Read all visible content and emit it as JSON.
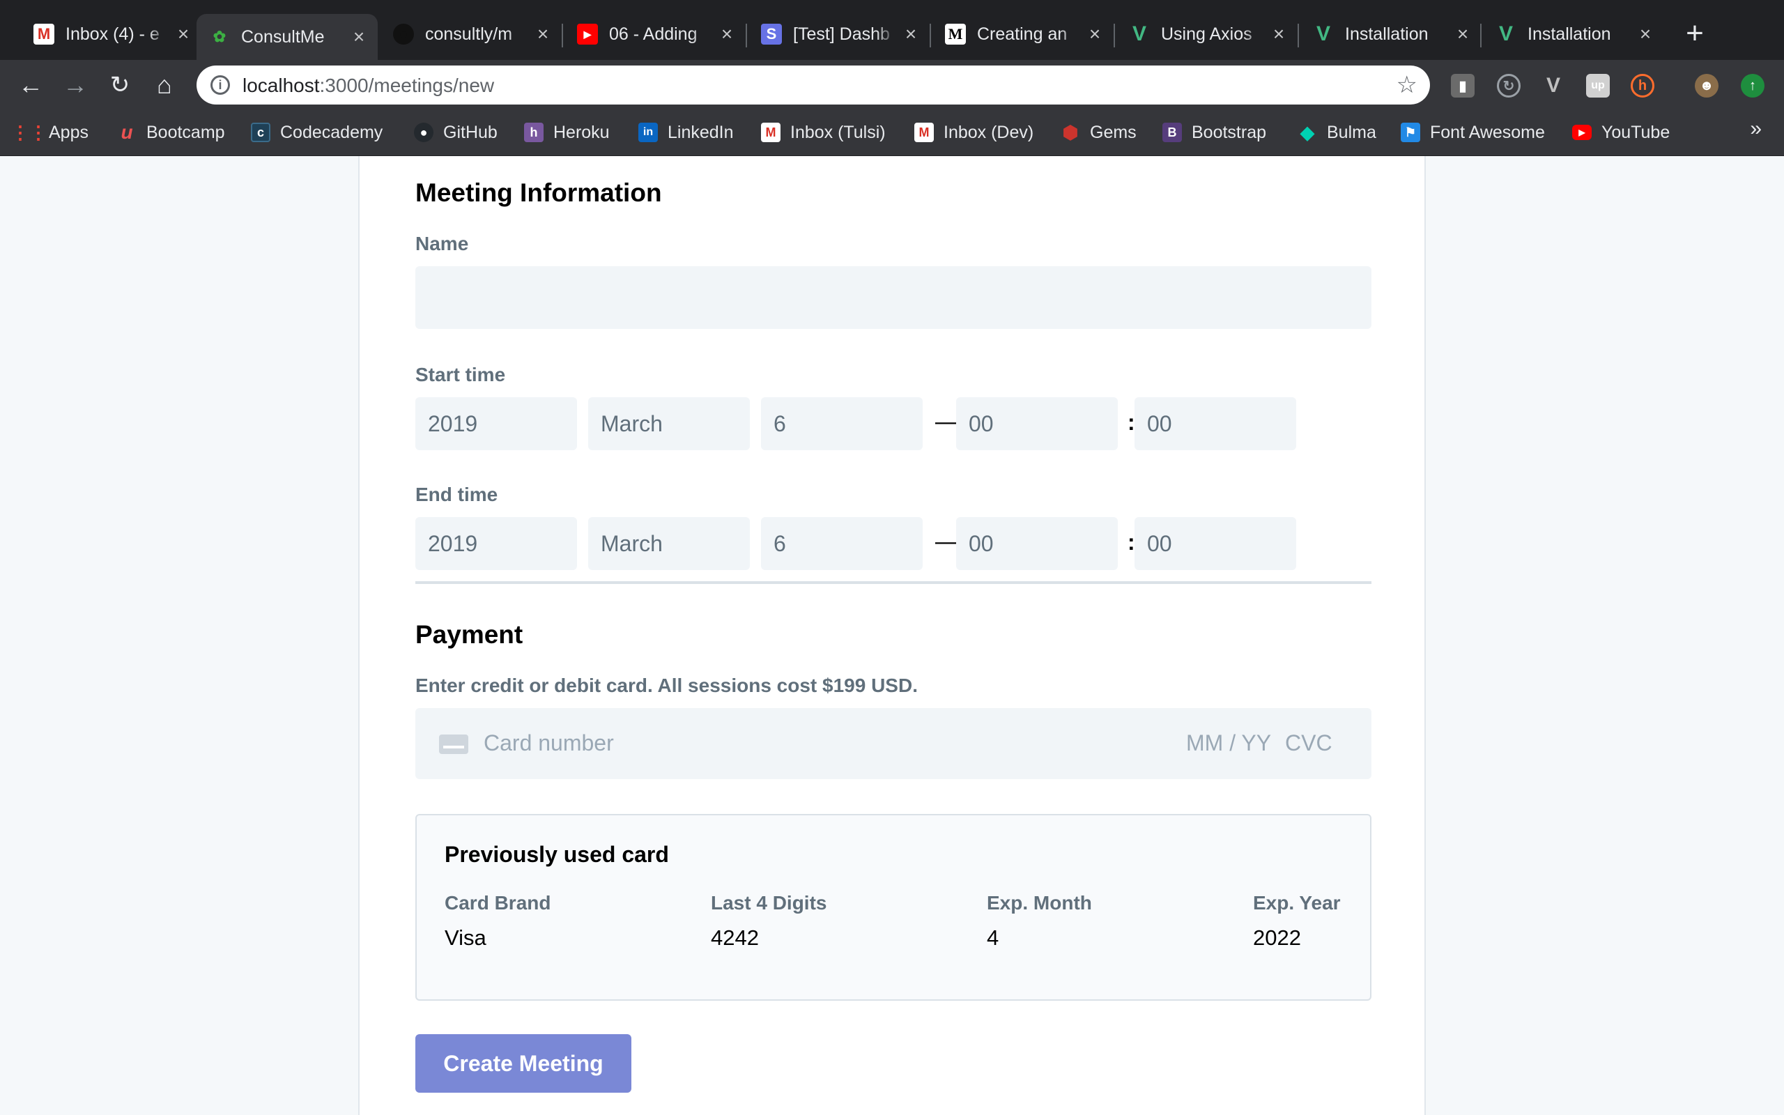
{
  "browser": {
    "tabs": [
      {
        "title": "Inbox (4) - e",
        "icon": "gmail-icon",
        "color": "#d93025",
        "glyph": "M"
      },
      {
        "title": "ConsultMe",
        "icon": "leaf-icon",
        "color": "#3cb043",
        "glyph": "✿"
      },
      {
        "title": "consultly/m",
        "icon": "github-icon",
        "color": "#111111",
        "glyph": "●"
      },
      {
        "title": "06 - Adding",
        "icon": "youtube-icon",
        "color": "#ff0000",
        "glyph": "▶"
      },
      {
        "title": "[Test] Dashb",
        "icon": "stripe-icon",
        "color": "#6772e5",
        "glyph": "S"
      },
      {
        "title": "Creating an",
        "icon": "medium-icon",
        "color": "#000000",
        "glyph": "M"
      },
      {
        "title": "Using Axios",
        "icon": "vue-icon",
        "color": "#42b883",
        "glyph": "V"
      },
      {
        "title": "Installation",
        "icon": "vue-icon",
        "color": "#42b883",
        "glyph": "V"
      },
      {
        "title": "Installation",
        "icon": "vue-icon",
        "color": "#42b883",
        "glyph": "V"
      }
    ],
    "active_tab": 1,
    "url_host": "localhost",
    "url_path": ":3000/meetings/new",
    "bookmarks": [
      {
        "label": "Apps",
        "icon": "apps-grid-icon",
        "color": "#ea4335",
        "glyph": "⋮"
      },
      {
        "label": "Bootcamp",
        "icon": "udemy-icon",
        "color": "#ec5252",
        "glyph": "u"
      },
      {
        "label": "Codecademy",
        "icon": "codecademy-icon",
        "color": "#1f4056",
        "glyph": "c"
      },
      {
        "label": "GitHub",
        "icon": "github-icon",
        "color": "#24292e",
        "glyph": "●"
      },
      {
        "label": "Heroku",
        "icon": "heroku-icon",
        "color": "#79589f",
        "glyph": "h"
      },
      {
        "label": "LinkedIn",
        "icon": "linkedin-icon",
        "color": "#0a66c2",
        "glyph": "in"
      },
      {
        "label": "Inbox (Tulsi)",
        "icon": "gmail-icon",
        "color": "#d93025",
        "glyph": "M"
      },
      {
        "label": "Inbox (Dev)",
        "icon": "gmail-icon",
        "color": "#d93025",
        "glyph": "M"
      },
      {
        "label": "Gems",
        "icon": "ruby-icon",
        "color": "#cc342d",
        "glyph": "◆"
      },
      {
        "label": "Bootstrap",
        "icon": "bootstrap-icon",
        "color": "#563d7c",
        "glyph": "B"
      },
      {
        "label": "Bulma",
        "icon": "bulma-icon",
        "color": "#00d1b2",
        "glyph": "◆"
      },
      {
        "label": "Font Awesome",
        "icon": "flag-icon",
        "color": "#228ae6",
        "glyph": "⚑"
      },
      {
        "label": "YouTube",
        "icon": "youtube-icon",
        "color": "#ff0000",
        "glyph": "▶"
      }
    ],
    "more_bookmarks": "»"
  },
  "form": {
    "meeting_title": "Meeting Information",
    "name_label": "Name",
    "name_value": "",
    "start_label": "Start time",
    "start": {
      "year": "2019",
      "month": "March",
      "day": "6",
      "hour": "00",
      "minute": "00"
    },
    "end_label": "End time",
    "end": {
      "year": "2019",
      "month": "March",
      "day": "6",
      "hour": "00",
      "minute": "00"
    },
    "dash": "—",
    "colon": ":",
    "payment_title": "Payment",
    "payment_hint": "Enter credit or debit card. All sessions cost $199 USD.",
    "card_placeholder": "Card number",
    "exp_placeholder": "MM / YY",
    "cvc_placeholder": "CVC",
    "previous_card": {
      "title": "Previously used card",
      "brand_label": "Card Brand",
      "brand": "Visa",
      "last4_label": "Last 4 Digits",
      "last4": "4242",
      "exp_month_label": "Exp. Month",
      "exp_month": "4",
      "exp_year_label": "Exp. Year",
      "exp_year": "2022"
    },
    "submit_label": "Create Meeting",
    "accent_color": "#7a88d6"
  }
}
